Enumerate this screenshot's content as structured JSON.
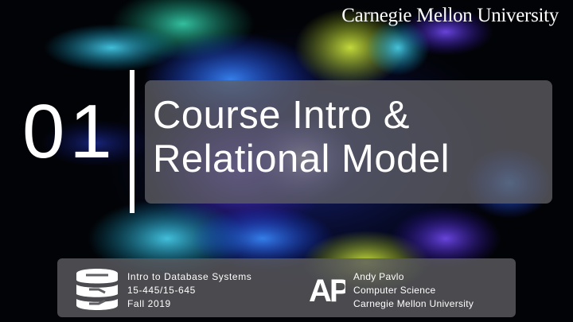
{
  "header": {
    "university": "Carnegie Mellon University"
  },
  "lecture": {
    "number": "01",
    "title_line1": "Course Intro &",
    "title_line2": "Relational Model"
  },
  "course": {
    "name": "Intro to Database Systems",
    "code": "15-445/15-645",
    "term": "Fall 2019"
  },
  "author": {
    "logo": "AP",
    "name": "Andy Pavlo",
    "department": "Computer Science",
    "university": "Carnegie Mellon University"
  },
  "icons": {
    "course_icon": "database-icon",
    "author_icon": "ap-logo-icon"
  },
  "colors": {
    "text": "#ffffff",
    "panel": "#5f5f64",
    "background": "#020306"
  }
}
